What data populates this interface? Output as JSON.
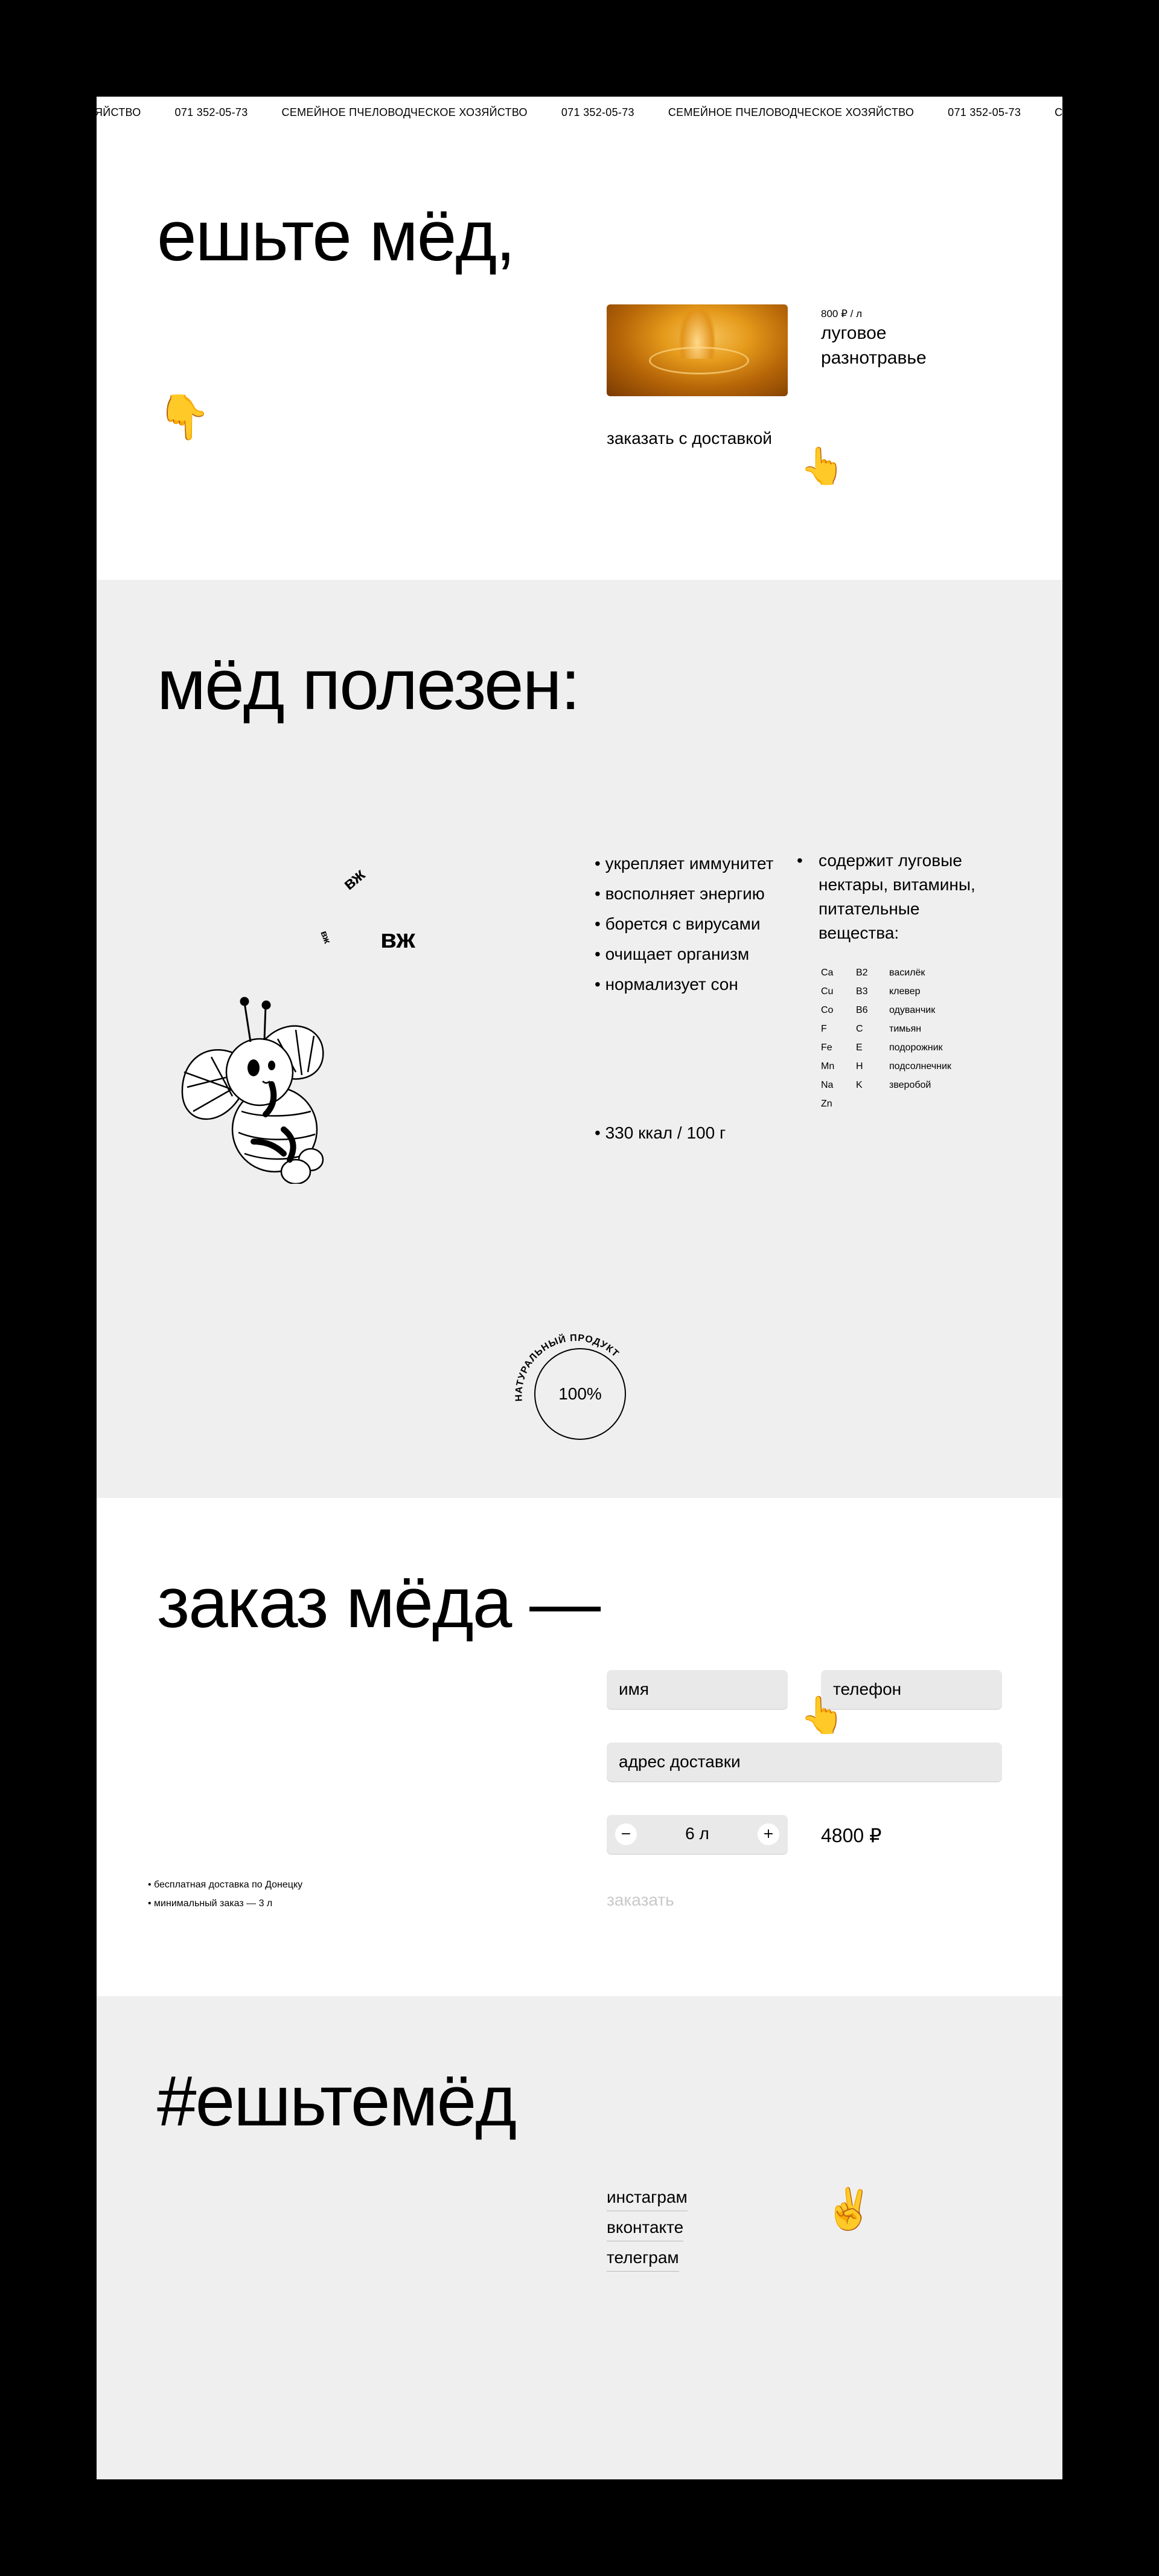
{
  "marquee": {
    "items": [
      "хозяйство",
      "071 352-05-73",
      "семейное пчеловодческое хозяйство",
      "071 352-05-73",
      "семейное пчеловодческое хозяйство",
      "071 352-05-73",
      "семейное пчеловодческое хозяйство"
    ]
  },
  "hero": {
    "title": "ешьте мёд,",
    "point_down_emoji": "👇",
    "point_emoji": "👆",
    "product": {
      "price": "800 ₽ / л",
      "name": "луговое разнотравье"
    },
    "order_link": "заказать с доставкой"
  },
  "benefits": {
    "title": "мёд полезен:",
    "list": [
      "укрепляет иммунитет",
      "восполняет энергию",
      "борется с вирусами",
      "очищает организм",
      "нормализует сон"
    ],
    "kcal": "330 ккал / 100 г",
    "nectar": "содержит луговые нектары, витамины, питательные вещества:",
    "minerals": [
      "Ca",
      "Cu",
      "Co",
      "F",
      "Fe",
      "Mn",
      "Na",
      "Zn"
    ],
    "vitamins": [
      "B2",
      "B3",
      "B6",
      "C",
      "E",
      "H",
      "K"
    ],
    "plants": [
      "василёк",
      "клевер",
      "одуванчик",
      "тимьян",
      "подорожник",
      "подсолнечник",
      "зверобой"
    ],
    "buzz": [
      "вж",
      "вж",
      "вж"
    ],
    "badge": {
      "arc_text": "натуральный продукт",
      "percent": "100%"
    }
  },
  "order": {
    "title": "заказ мёда —",
    "name_placeholder": "имя",
    "phone_placeholder": "телефон",
    "address_placeholder": "адрес доставки",
    "minus": "−",
    "plus": "+",
    "quantity": "6 л",
    "total": "4800 ₽",
    "submit": "заказать",
    "emoji": "👆",
    "notes": [
      "бесплатная доставка по Донецку",
      "минимальный заказ — 3 л"
    ]
  },
  "footer": {
    "title": "#ешьтемёд",
    "links": [
      "инстаграм",
      "вконтакте",
      "телеграм"
    ],
    "emoji": "✌️"
  },
  "colors": {
    "grey_bg": "#efefef",
    "field_bg": "#e9e9e9",
    "honey": "#e59a1b"
  }
}
